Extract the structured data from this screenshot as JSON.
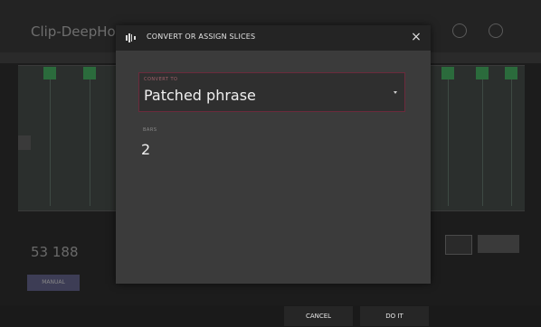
{
  "background": {
    "clip_title": "Clip-DeepHouse",
    "value_readout": "53 188",
    "manual_button": "MANUAL"
  },
  "dialog": {
    "title": "CONVERT OR ASSIGN SLICES",
    "close_symbol": "×",
    "convert_to": {
      "label": "CONVERT TO",
      "value": "Patched phrase"
    },
    "bars": {
      "label": "BARS",
      "value": "2"
    }
  },
  "actions": {
    "cancel_label": "CANCEL",
    "do_it_label": "DO IT"
  },
  "colors": {
    "accent": "#6b2a3c",
    "marker_green": "#2b6b3c"
  },
  "icons": {
    "dialog_icon": "slices-icon",
    "close_icon": "close-icon",
    "dropdown_icon": "chevron-down-icon"
  }
}
